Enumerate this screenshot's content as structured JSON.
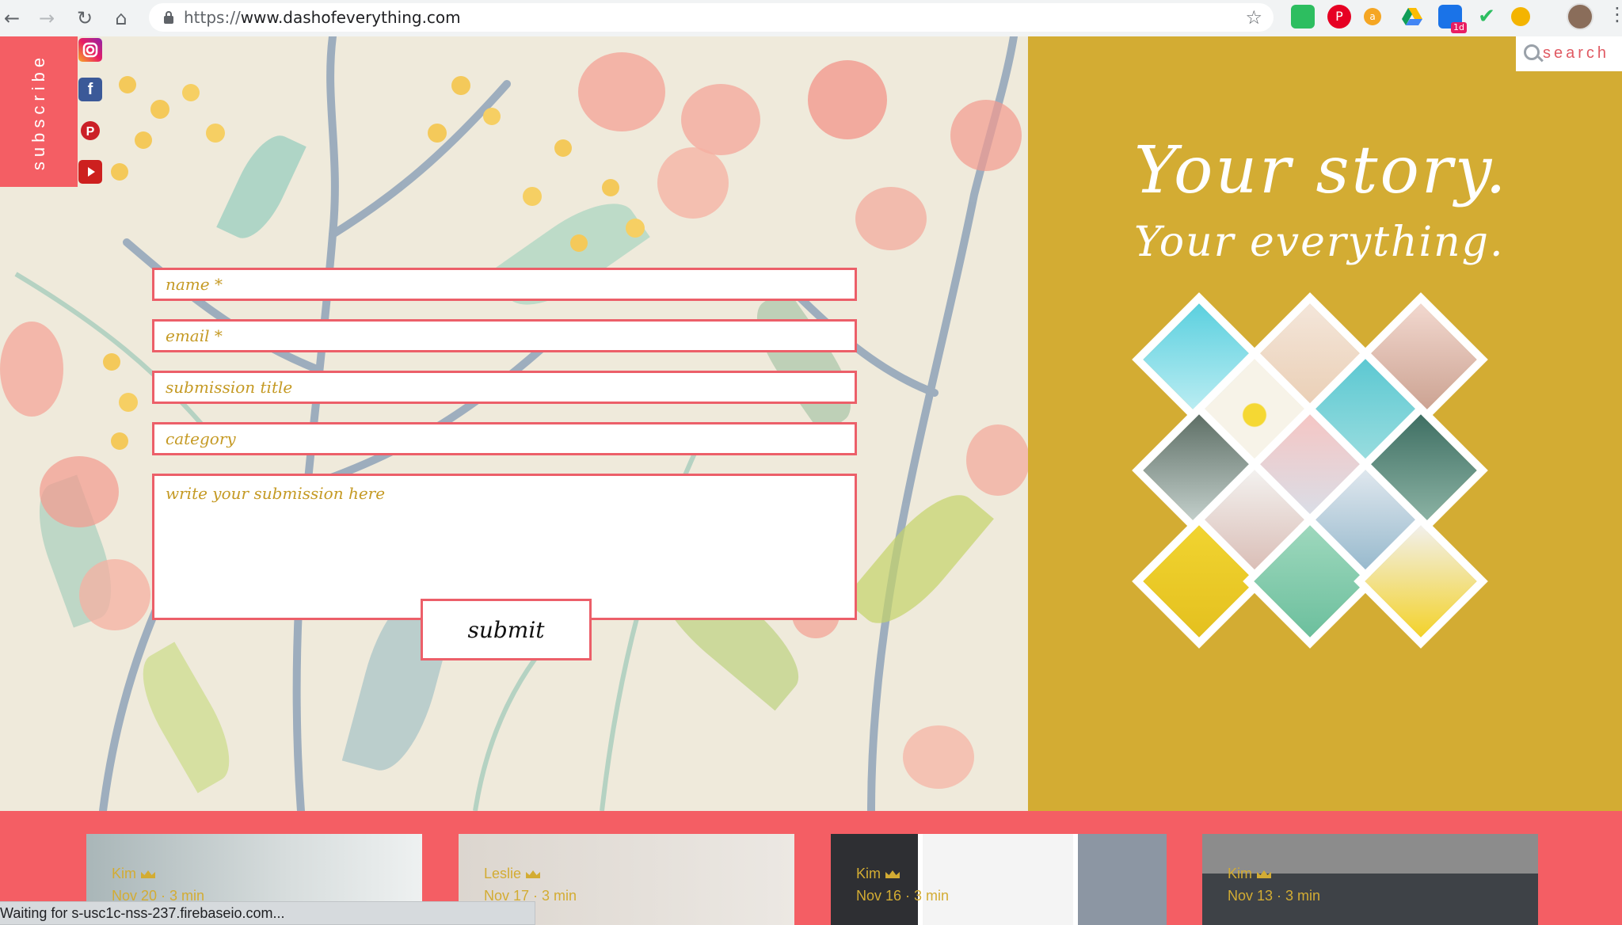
{
  "browser": {
    "url_scheme": "https://",
    "url_host": "www.dashofeverything.com",
    "back_glyph": "←",
    "forward_glyph": "→",
    "reload_glyph": "↻",
    "home_glyph": "⌂",
    "star_glyph": "☆",
    "menu_glyph": "⋮",
    "extension_badge": "1d"
  },
  "sidebar": {
    "subscribe_label": "subscribe",
    "social": [
      "instagram-icon",
      "facebook-icon",
      "pinterest-icon",
      "youtube-icon"
    ]
  },
  "search": {
    "label": "search"
  },
  "hero": {
    "tagline_line1": "Your story.",
    "tagline_line2": "Your everything."
  },
  "form": {
    "name_placeholder": "name *",
    "email_placeholder": "email *",
    "title_placeholder": "submission title",
    "category_placeholder": "category",
    "body_placeholder": "write your submission here",
    "submit_label": "submit"
  },
  "posts": [
    {
      "author": "Kim",
      "date": "Nov 20",
      "read_time": "3 min"
    },
    {
      "author": "Leslie",
      "date": "Nov 17",
      "read_time": "3 min"
    },
    {
      "author": "Kim",
      "date": "Nov 16",
      "read_time": "3 min"
    },
    {
      "author": "Kim",
      "date": "Nov 13",
      "read_time": "3 min"
    }
  ],
  "status_bar": "Waiting for s-usc1c-nss-237.firebaseio.com...",
  "colors": {
    "coral": "#f45e64",
    "mustard": "#d3ac33",
    "cream": "#efeadb"
  }
}
